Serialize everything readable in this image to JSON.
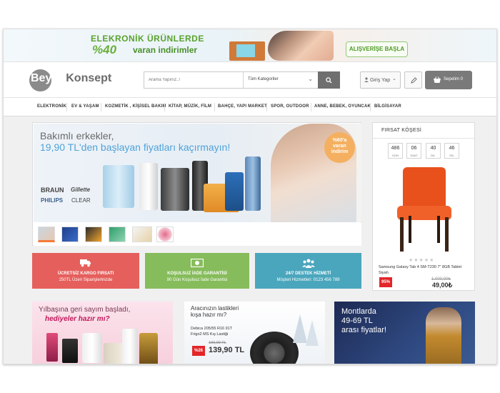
{
  "top_banner": {
    "line1": "ELEKRONİK ÜRÜNLERDE",
    "percent": "%40",
    "line2": "varan indirimler",
    "button": "ALIŞVERİŞE BAŞLA"
  },
  "header": {
    "logo_word1": "Beyaz",
    "logo_word2": "Konsept",
    "search_placeholder": "Arama Yapınız..!",
    "search_category": "Tüm Kategoriler",
    "login_label": "Giriş Yap",
    "cart_label": "Sepetim 0"
  },
  "nav": {
    "items": [
      "ELEKTRONİK",
      "EV & YAŞAM",
      "KOZMETİK , KİŞİSEL BAKIM",
      "KİTAP, MÜZİK, FİLM",
      "BAHÇE, YAPI MARKET",
      "SPOR, OUTDOOR",
      "ANNE, BEBEK, OYUNCAK",
      "BİLGİSAYAR"
    ]
  },
  "hero": {
    "line1": "Bakımlı erkekler,",
    "line2": "19,90 TL'den başlayan fiyatları kaçırmayın!",
    "badge_line1": "%60'a",
    "badge_line2": "varan",
    "badge_line3": "indirim",
    "brands": [
      "BRAUN",
      "Gillette",
      "PHILIPS",
      "CLEAR"
    ]
  },
  "features": [
    {
      "title": "ÜCRETSİZ KARGO FIRSATI",
      "subtitle": "250TL Üzeri Siparişlerinizde",
      "icon": "truck-icon",
      "color": "#e55f5c"
    },
    {
      "title": "KOŞULSUZ İADE GARANTİSİ",
      "subtitle": "90 Gün Koşulsuz İade Garantisi",
      "icon": "money-icon",
      "color": "#86bc5b"
    },
    {
      "title": "24/7 DESTEK HİZMETİ",
      "subtitle": "Müşteri Hizmetleri: 0123 456 789",
      "icon": "people-icon",
      "color": "#4aa6bd"
    }
  ],
  "promos": {
    "p1_line1": "Yılbaşına geri sayım başladı,",
    "p1_line2": "hediyeler hazır mı?",
    "p2_line1": "Aracınızın lastikleri",
    "p2_line2": "kışa hazır mı?",
    "p2_product1": "Debica 205/55 R16 91T",
    "p2_product2": "Frigo2 MS Kış Lastiği",
    "p2_old_price": "190,99 TL",
    "p2_discount": "%26",
    "p2_price": "139,90 TL",
    "p3_line1": "Montlarda",
    "p3_line2": "49-69 TL",
    "p3_line3": "arası fiyatlar!"
  },
  "firsat": {
    "title": "FIRSAT KÖŞESİ",
    "countdown": [
      {
        "value": "486",
        "label": "GÜN"
      },
      {
        "value": "06",
        "label": "SAAT"
      },
      {
        "value": "40",
        "label": "DK."
      },
      {
        "value": "46",
        "label": "SN."
      }
    ],
    "stars": "★★★★★",
    "rating": 0,
    "product_name": "Samsung Galaxy Tab 4 SM-T230 7\" 8GB Tablet Siyah",
    "discount": "95%",
    "old_price": "1.000,00₺",
    "new_price": "49,00₺"
  }
}
